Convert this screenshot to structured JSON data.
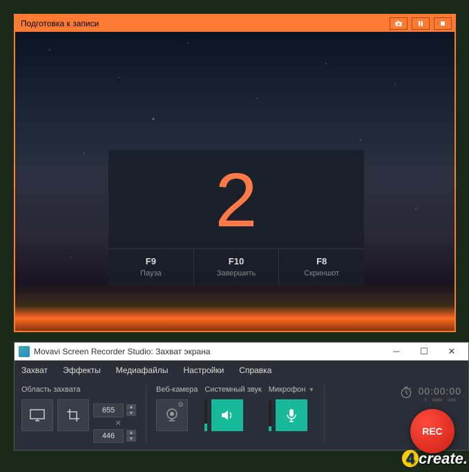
{
  "overlay": {
    "title": "Подготовка к записи"
  },
  "countdown": {
    "number": "2",
    "hotkeys": [
      {
        "key": "F9",
        "label": "Пауза"
      },
      {
        "key": "F10",
        "label": "Завершить"
      },
      {
        "key": "F8",
        "label": "Скриншот"
      }
    ]
  },
  "window": {
    "title": "Movavi Screen Recorder Studio: Захват экрана"
  },
  "menu": {
    "items": [
      "Захват",
      "Эффекты",
      "Медиафайлы",
      "Настройки",
      "Справка"
    ]
  },
  "capture": {
    "label": "Область захвата",
    "width": "655",
    "height": "446",
    "cross": "✕"
  },
  "sources": {
    "webcam": "Веб-камера",
    "system_audio": "Системный звук",
    "microphone": "Микрофон"
  },
  "timer": {
    "digits": "00:00:00",
    "labels": [
      "ч",
      "мин",
      "сек"
    ]
  },
  "rec": {
    "label": "REC"
  },
  "watermark": {
    "text": "4create."
  }
}
